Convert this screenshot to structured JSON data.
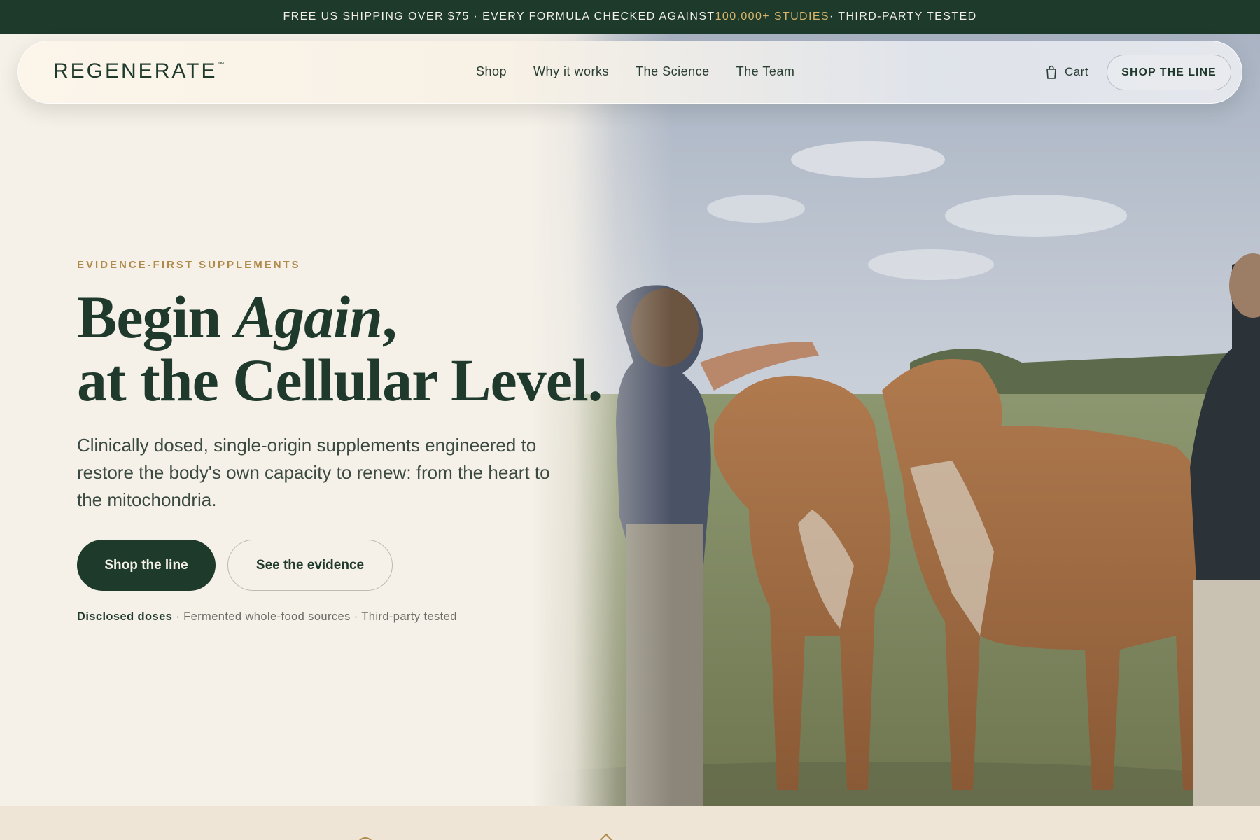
{
  "announcement": {
    "part1": "FREE US SHIPPING OVER $75 · EVERY FORMULA CHECKED AGAINST ",
    "highlight": "100,000+ STUDIES",
    "part2": " · THIRD-PARTY TESTED"
  },
  "nav": {
    "brand": "REGENERATE",
    "trademark": "™",
    "links": [
      "Shop",
      "Why it works",
      "The Science",
      "The Team"
    ],
    "cart_label": "Cart",
    "cta_label": "SHOP THE LINE"
  },
  "hero": {
    "eyebrow": "EVIDENCE-FIRST SUPPLEMENTS",
    "headline_line1_start": "Begin ",
    "headline_line1_italic": "Again",
    "headline_line1_end": ",",
    "headline_line2": "at the Cellular Level.",
    "subtext": "Clinically dosed, single-origin supplements engineered to restore the body's own capacity to renew: from the heart to the mitochondria.",
    "primary_button": "Shop the line",
    "secondary_button": "See the evidence",
    "features": {
      "first": "Disclosed doses",
      "rest": " · Fermented whole-food sources · Third-party tested"
    }
  },
  "colors": {
    "brand_green": "#1d3a2b",
    "accent_gold": "#b08a4a",
    "background_cream": "#f5f0e8"
  }
}
